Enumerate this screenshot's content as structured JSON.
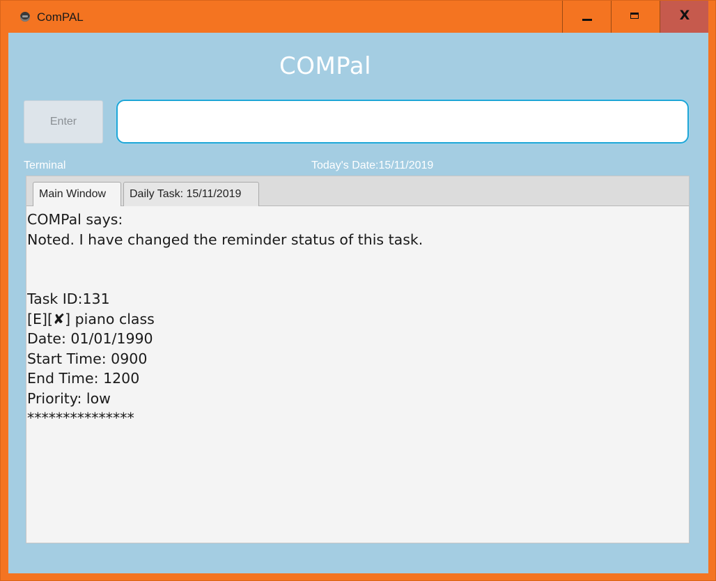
{
  "window": {
    "title": "ComPAL",
    "icon": "app-icon",
    "controls": {
      "minimize": "minimize-icon",
      "maximize": "maximize-icon",
      "close_label": "X"
    }
  },
  "header": {
    "app_title": "COMPal"
  },
  "command": {
    "enter_label": "Enter",
    "input_value": "",
    "input_placeholder": ""
  },
  "status": {
    "terminal_label": "Terminal",
    "date_label": "Today's Date:15/11/2019"
  },
  "tabs": [
    {
      "label": "Main Window",
      "selected": true
    },
    {
      "label": "Daily Task: 15/11/2019",
      "selected": false
    }
  ],
  "output": {
    "lines": [
      "COMPal says:",
      "Noted. I have changed the reminder status of this task.",
      "",
      "",
      "Task ID:131",
      "[E][✘] piano class",
      "Date: 01/01/1990",
      "Start Time: 0900",
      "End Time: 1200",
      "Priority: low",
      "***************"
    ]
  },
  "colors": {
    "window_frame": "#f47421",
    "client_background": "#a4cde2",
    "close_button": "#c65a4d",
    "input_border": "#1ea5d6",
    "output_background": "#f4f4f4"
  }
}
